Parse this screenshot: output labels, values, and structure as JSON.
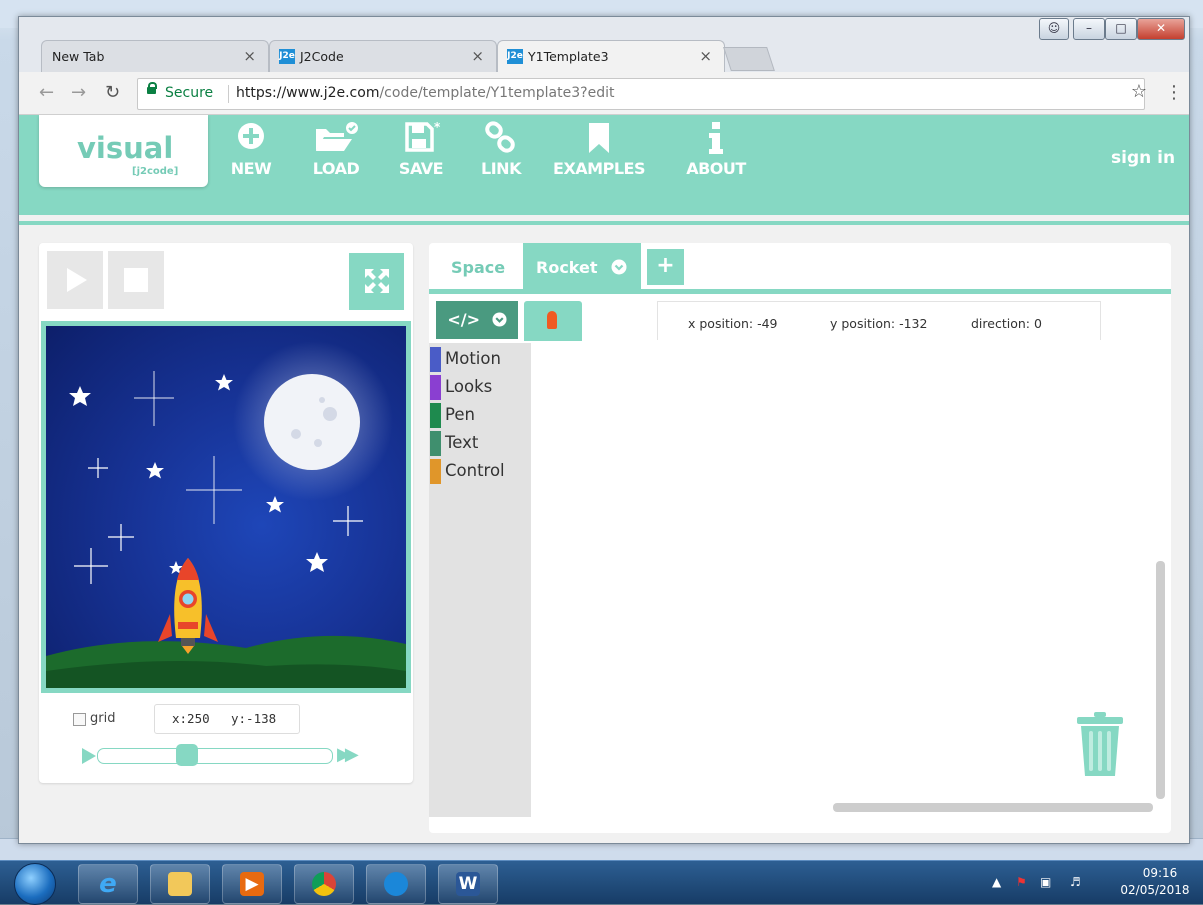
{
  "browser": {
    "tabs": [
      {
        "title": "New Tab",
        "favicon": ""
      },
      {
        "title": "J2Code",
        "favicon": "J2e"
      },
      {
        "title": "Y1Template3",
        "favicon": "J2e"
      }
    ],
    "tab_close_glyph": "×",
    "url_secure_label": "Secure",
    "url_host": "https://www.j2e.com",
    "url_path": "/code/template/Y1template3?edit"
  },
  "site": {
    "logo_main": "visual",
    "logo_sub": "[j2code]",
    "nav": [
      {
        "label": "NEW",
        "icon": "plus-circle-icon"
      },
      {
        "label": "LOAD",
        "icon": "folder-open-icon"
      },
      {
        "label": "SAVE",
        "icon": "floppy-icon"
      },
      {
        "label": "LINK",
        "icon": "link-icon"
      },
      {
        "label": "EXAMPLES",
        "icon": "bookmark-icon"
      },
      {
        "label": "ABOUT",
        "icon": "info-icon"
      }
    ],
    "signin_label": "sign in",
    "accent": "#86d8c3"
  },
  "stage": {
    "grid_label": "grid",
    "coord_x": "x:250",
    "coord_y": "y:-138",
    "speed_fraction": 0.37
  },
  "editor": {
    "sprite_tabs": [
      "Space",
      "Rocket"
    ],
    "add_tab_label": "+",
    "code_toggle_label": "</>",
    "sprite_info": {
      "x": "x position: -49",
      "y": "y position: -132",
      "direction": "direction: 0"
    },
    "categories": [
      {
        "label": "Motion",
        "color": "#4a5cc7"
      },
      {
        "label": "Looks",
        "color": "#8a3fd1"
      },
      {
        "label": "Pen",
        "color": "#1e8a4e"
      },
      {
        "label": "Text",
        "color": "#3f8f6e"
      },
      {
        "label": "Control",
        "color": "#e0962a"
      }
    ]
  },
  "taskbar": {
    "time": "09:16",
    "date": "02/05/2018"
  }
}
